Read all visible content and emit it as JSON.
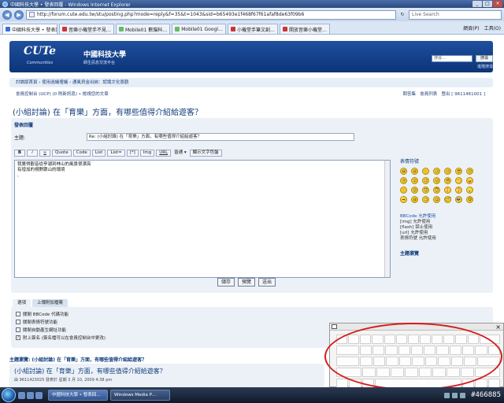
{
  "window": {
    "title": "中國科技大學 • 發表回覆 - Windows Internet Explorer",
    "minimize_label": "_",
    "maximize_label": "□",
    "close_label": "×"
  },
  "browser": {
    "back_label": "◀",
    "forward_label": "▶",
    "address": "http://forum.cute.edu.tw/stu/posting.php?mode=reply&f=35&t=1043&sid=b65493e1f468f67f61afaf8de63f09b6",
    "refresh_label": "↻",
    "search_placeholder": "Live Search",
    "tabs": [
      {
        "label": "中國科技大學 • 發表回覆",
        "active": true
      },
      {
        "label": "音樂小機堂手不見…"
      },
      {
        "label": "Mobile01 數貓科…"
      },
      {
        "label": "Mobile01 Googl…"
      },
      {
        "label": "小機堂手筆文創…"
      },
      {
        "label": "開放音樂小機堂…"
      }
    ],
    "toolbar": {
      "page_label": "網頁(P)",
      "tools_label": "工具(O)"
    }
  },
  "header": {
    "logo_text": "CUTe",
    "logo_sub": "Communities",
    "school_name": "中國科技大學",
    "school_sub": "師生訊息交流平台",
    "search_placeholder": "搜尋…",
    "search_button": "搜尋",
    "advanced_search": "進階搜尋"
  },
  "nav": {
    "breadcrumb": "討論版首頁 ‹ 使用過議壇議 ‹ 通風資金出納：認識文化景觀",
    "ucp_links": "會員控制台 (UCP) (0 則新訊息) • 檢視您的文章",
    "faq": "問答集",
    "members": "會員列表",
    "logout": "登出 [ 9611461001 ]"
  },
  "topic": {
    "title": "(小組討論) 在「育樂」方面，有哪些值得介紹給遊客？"
  },
  "form": {
    "panel_title": "發表回覆",
    "subject_label": "主題:",
    "subject_value": "Re: (小組討論) 在「育樂」方面，有哪些值得介紹給遊客？",
    "toolbar_buttons": [
      "B",
      "i",
      "u",
      "Quote",
      "Code",
      "List",
      "List=",
      "[*]",
      "Img",
      "URL"
    ],
    "font_size_label": "普通",
    "font_color_label": "顯示文字色盤",
    "body_lines": [
      "我覺得觀音從亭湖到林山的風景很漂亮",
      "有增加的視野跟山的環境",
      ","
    ],
    "smilies_title": "表情符號",
    "smilies": [
      "😀",
      "😄",
      "🙂",
      "😉",
      "😐",
      "😎",
      "😠",
      "😢",
      "😮",
      "😕",
      "😛",
      "😳",
      "😬",
      "🤪",
      "🙁",
      "😡",
      "😈",
      "😇",
      "❗",
      "❓",
      "💡",
      "➡",
      "😆",
      "😏",
      "😋",
      "😴",
      "👽",
      "🐵"
    ],
    "bbcode_status": [
      "BBCode 允許使用",
      "[img] 允許使用",
      "[flash] 禁止使用",
      "[url] 允許使用",
      "表情符號 允許使用"
    ],
    "topic_review_link": "主題瀏覽",
    "submit": "送出",
    "preview": "預覽",
    "save": "儲存"
  },
  "options": {
    "tabs": [
      "選項",
      "上傳附加檔案"
    ],
    "items": [
      {
        "label": "關閉 BBCode 代碼功能",
        "checked": false
      },
      {
        "label": "關閉表情符號功能",
        "checked": false
      },
      {
        "label": "關閉自動產生網址功能",
        "checked": false
      },
      {
        "label": "附上簽名 (簽名檔可以在會員控制台中更改)",
        "checked": true
      }
    ]
  },
  "review": {
    "heading": "主題瀏覽: (小組討論) 在「育樂」方面，有哪些值得介紹給遊客？",
    "post_title": "(小組討論) 在「育樂」方面，有哪些值得介紹給遊客？",
    "meta": "由 9611423025 發表於 星期 3 月 10, 2009 4:38 pm"
  },
  "osk": {
    "close_label": "×"
  },
  "taskbar": {
    "tasks": [
      "中國科技大學 • 發表回…",
      "Windows Media P…"
    ],
    "watermark": "#466885"
  },
  "colors": {
    "header_blue": "#0c3478",
    "panel_bg": "#ecf1f7",
    "annotation_red": "#d51d1d"
  }
}
